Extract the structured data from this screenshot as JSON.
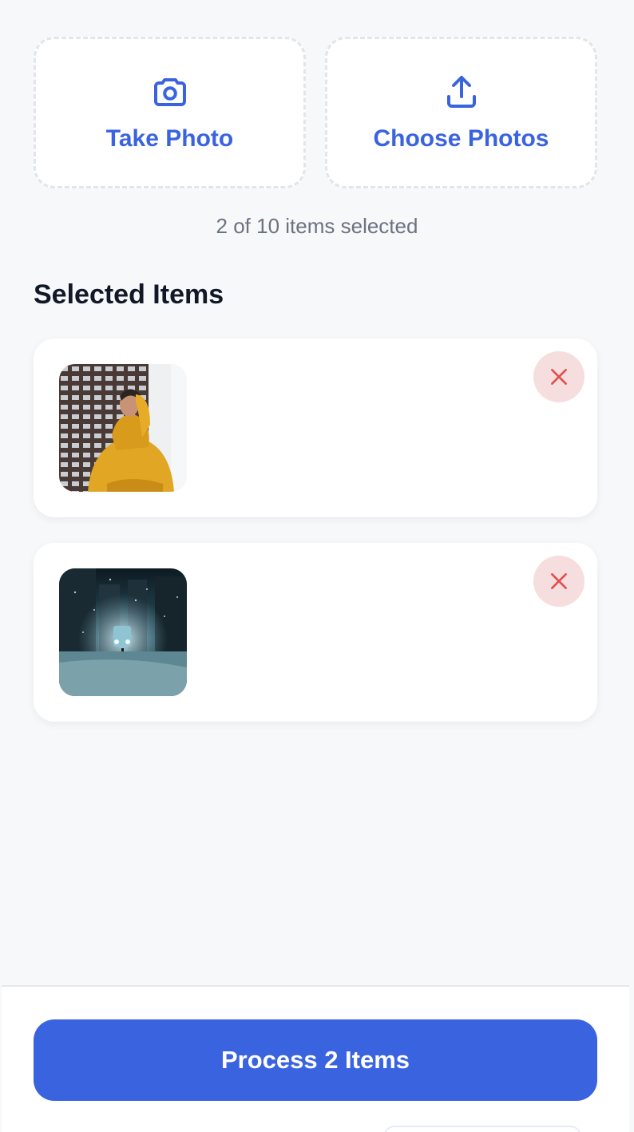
{
  "pickers": {
    "take_photo_label": "Take Photo",
    "take_photo_icon": "camera-icon",
    "choose_photos_label": "Choose Photos",
    "choose_photos_icon": "upload-icon",
    "accent_color": "#3a63e0"
  },
  "selection": {
    "count_text": "2 of 10 items selected",
    "selected_count": 2,
    "max_count": 10
  },
  "selected_items": {
    "title": "Selected Items",
    "items": [
      {
        "thumbnail": "person in yellow hoodie in front of building",
        "remove_icon": "close-icon"
      },
      {
        "thumbnail": "snowy city street at night",
        "remove_icon": "close-icon"
      }
    ]
  },
  "footer": {
    "process_label": "Process 2 Items",
    "button_color": "#3a63e0"
  }
}
